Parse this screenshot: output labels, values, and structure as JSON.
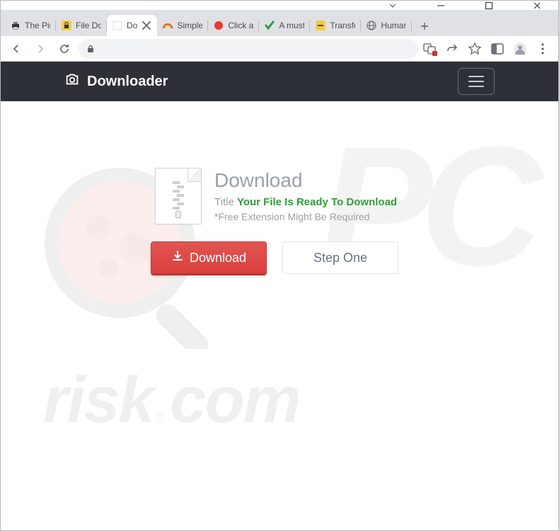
{
  "window": {
    "tabs": [
      {
        "title": "The Pir",
        "favicon": "printer"
      },
      {
        "title": "File Do",
        "favicon": "lock-yellow"
      },
      {
        "title": "Do",
        "favicon": "blank",
        "active": true
      },
      {
        "title": "Simple",
        "favicon": "rainbow"
      },
      {
        "title": "Click a",
        "favicon": "red-dot"
      },
      {
        "title": "A must",
        "favicon": "green-check"
      },
      {
        "title": "Transfe",
        "favicon": "yellow-sq"
      },
      {
        "title": "Human",
        "favicon": "globe"
      }
    ]
  },
  "header": {
    "brand": "Downloader"
  },
  "main": {
    "heading": "Download",
    "title_prefix": "Title ",
    "title_emph": "Your File Is Ready To Download",
    "note": "*Free Extension Might Be Required",
    "download_btn": "Download",
    "step_btn": "Step One"
  },
  "watermark": {
    "text_left": "risk",
    "text_dot": ".",
    "text_right": "com",
    "pc": "PC"
  }
}
